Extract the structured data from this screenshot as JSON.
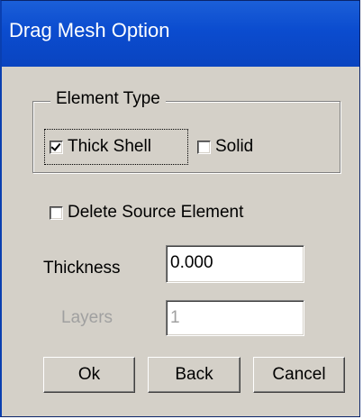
{
  "window": {
    "title": "Drag Mesh Option"
  },
  "element_type": {
    "label": "Element Type",
    "options": [
      {
        "label": "Thick Shell",
        "checked": true
      },
      {
        "label": "Solid",
        "checked": false
      }
    ]
  },
  "delete_source": {
    "label": "Delete Source Element",
    "checked": false
  },
  "thickness": {
    "label": "Thickness",
    "value": "0.000"
  },
  "layers": {
    "label": "Layers",
    "value": "1",
    "enabled": false
  },
  "buttons": {
    "ok": "Ok",
    "back": "Back",
    "cancel": "Cancel"
  },
  "colors": {
    "titlebar": "#0a44c0",
    "dialog_bg": "#d4d0c8",
    "disabled_text": "#a0a0a0"
  }
}
